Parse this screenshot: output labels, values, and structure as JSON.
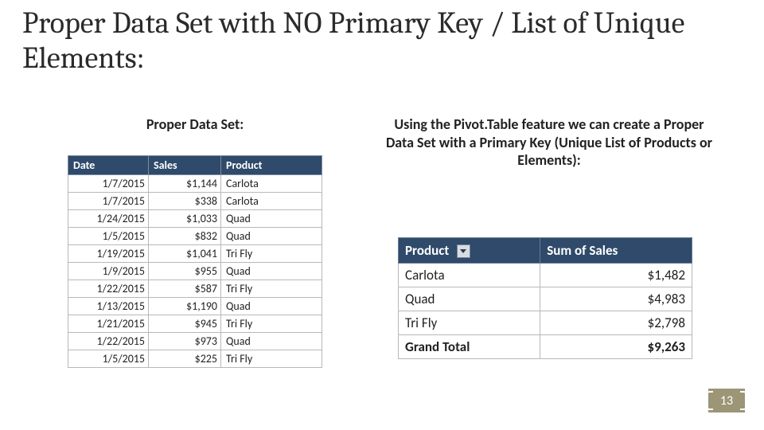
{
  "title": "Proper Data Set with NO Primary Key / List of Unique Elements:",
  "left_heading": "Proper Data Set:",
  "right_heading": "Using the Pivot.Table feature we can create a Proper Data Set with a Primary Key (Unique List of Products or Elements):",
  "data_table": {
    "headers": {
      "date": "Date",
      "sales": "Sales",
      "product": "Product"
    },
    "rows": [
      {
        "date": "1/7/2015",
        "sales": "$1,144",
        "product": "Carlota"
      },
      {
        "date": "1/7/2015",
        "sales": "$338",
        "product": "Carlota"
      },
      {
        "date": "1/24/2015",
        "sales": "$1,033",
        "product": "Quad"
      },
      {
        "date": "1/5/2015",
        "sales": "$832",
        "product": "Quad"
      },
      {
        "date": "1/19/2015",
        "sales": "$1,041",
        "product": "Tri Fly"
      },
      {
        "date": "1/9/2015",
        "sales": "$955",
        "product": "Quad"
      },
      {
        "date": "1/22/2015",
        "sales": "$587",
        "product": "Tri Fly"
      },
      {
        "date": "1/13/2015",
        "sales": "$1,190",
        "product": "Quad"
      },
      {
        "date": "1/21/2015",
        "sales": "$945",
        "product": "Tri Fly"
      },
      {
        "date": "1/22/2015",
        "sales": "$973",
        "product": "Quad"
      },
      {
        "date": "1/5/2015",
        "sales": "$225",
        "product": "Tri Fly"
      }
    ]
  },
  "pivot_table": {
    "headers": {
      "product": "Product",
      "sum": "Sum of Sales"
    },
    "rows": [
      {
        "product": "Carlota",
        "sum": "$1,482"
      },
      {
        "product": "Quad",
        "sum": "$4,983"
      },
      {
        "product": "Tri Fly",
        "sum": "$2,798"
      }
    ],
    "grand_total": {
      "label": "Grand Total",
      "sum": "$9,263"
    }
  },
  "page_number": "13"
}
